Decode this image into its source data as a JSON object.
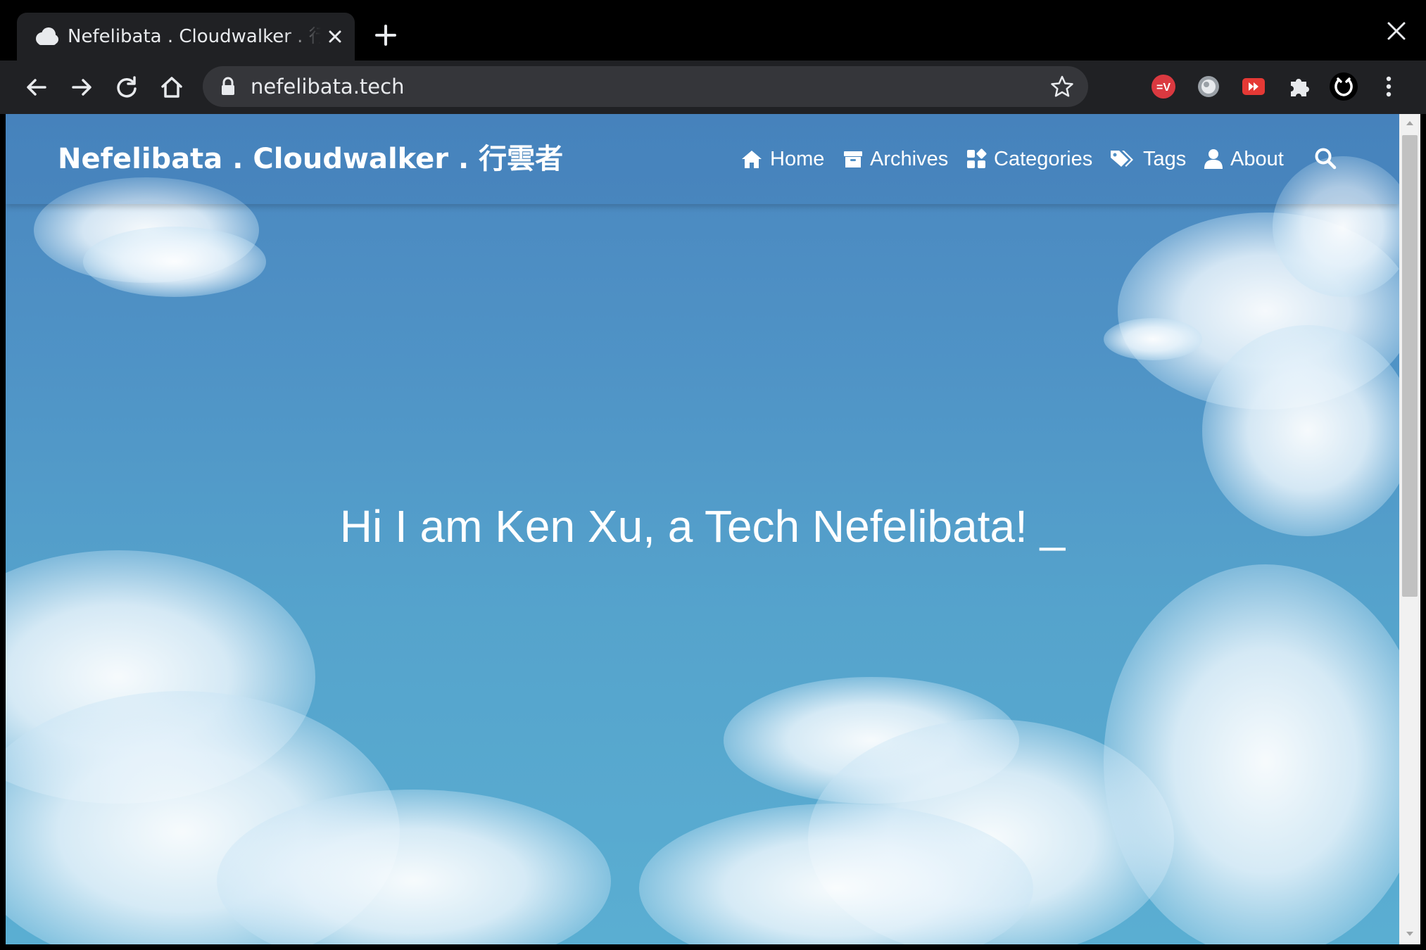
{
  "browser": {
    "tab": {
      "title": "Nefelibata . Cloudwalker . 行雲者"
    },
    "address_bar": {
      "url": "nefelibata.tech"
    },
    "extensions": [
      "expressvpn-icon",
      "vpn-globe-icon",
      "video-speed-icon",
      "puzzle-extensions-icon",
      "profile-avatar-icon"
    ]
  },
  "site": {
    "brand": "Nefelibata . Cloudwalker . 行雲者",
    "nav": {
      "home": "Home",
      "archives": "Archives",
      "categories": "Categories",
      "tags": "Tags",
      "about": "About"
    },
    "hero": {
      "text": "Hi I am Ken Xu, a Tech Nefelibata! _"
    }
  },
  "colors": {
    "tab_strip": "#000000",
    "toolbar": "#202124",
    "omnibox": "#35363a",
    "sky_top": "#4a86bf",
    "sky_bottom": "#5aaed2"
  }
}
